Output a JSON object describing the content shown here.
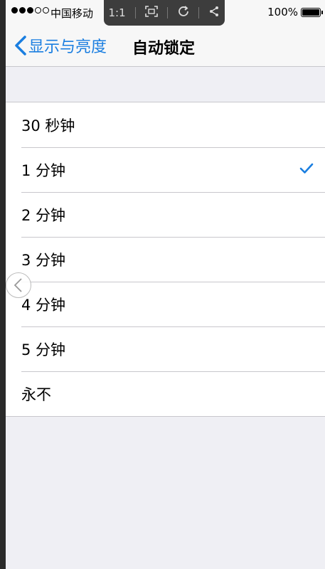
{
  "status_bar": {
    "carrier": "中国移动",
    "battery": "100%"
  },
  "toolbar": {
    "ratio": "1:1",
    "icons": [
      "fit-screen-icon",
      "rotate-icon",
      "share-icon"
    ]
  },
  "nav": {
    "back_label": "显示与亮度",
    "title": "自动锁定"
  },
  "options": [
    {
      "label": "30 秒钟",
      "selected": false
    },
    {
      "label": "1 分钟",
      "selected": true
    },
    {
      "label": "2 分钟",
      "selected": false
    },
    {
      "label": "3 分钟",
      "selected": false
    },
    {
      "label": "4 分钟",
      "selected": false
    },
    {
      "label": "5 分钟",
      "selected": false
    },
    {
      "label": "永不",
      "selected": false
    }
  ],
  "colors": {
    "accent": "#1a7ee0",
    "background": "#efeff4",
    "separator": "#c8c7cc"
  }
}
